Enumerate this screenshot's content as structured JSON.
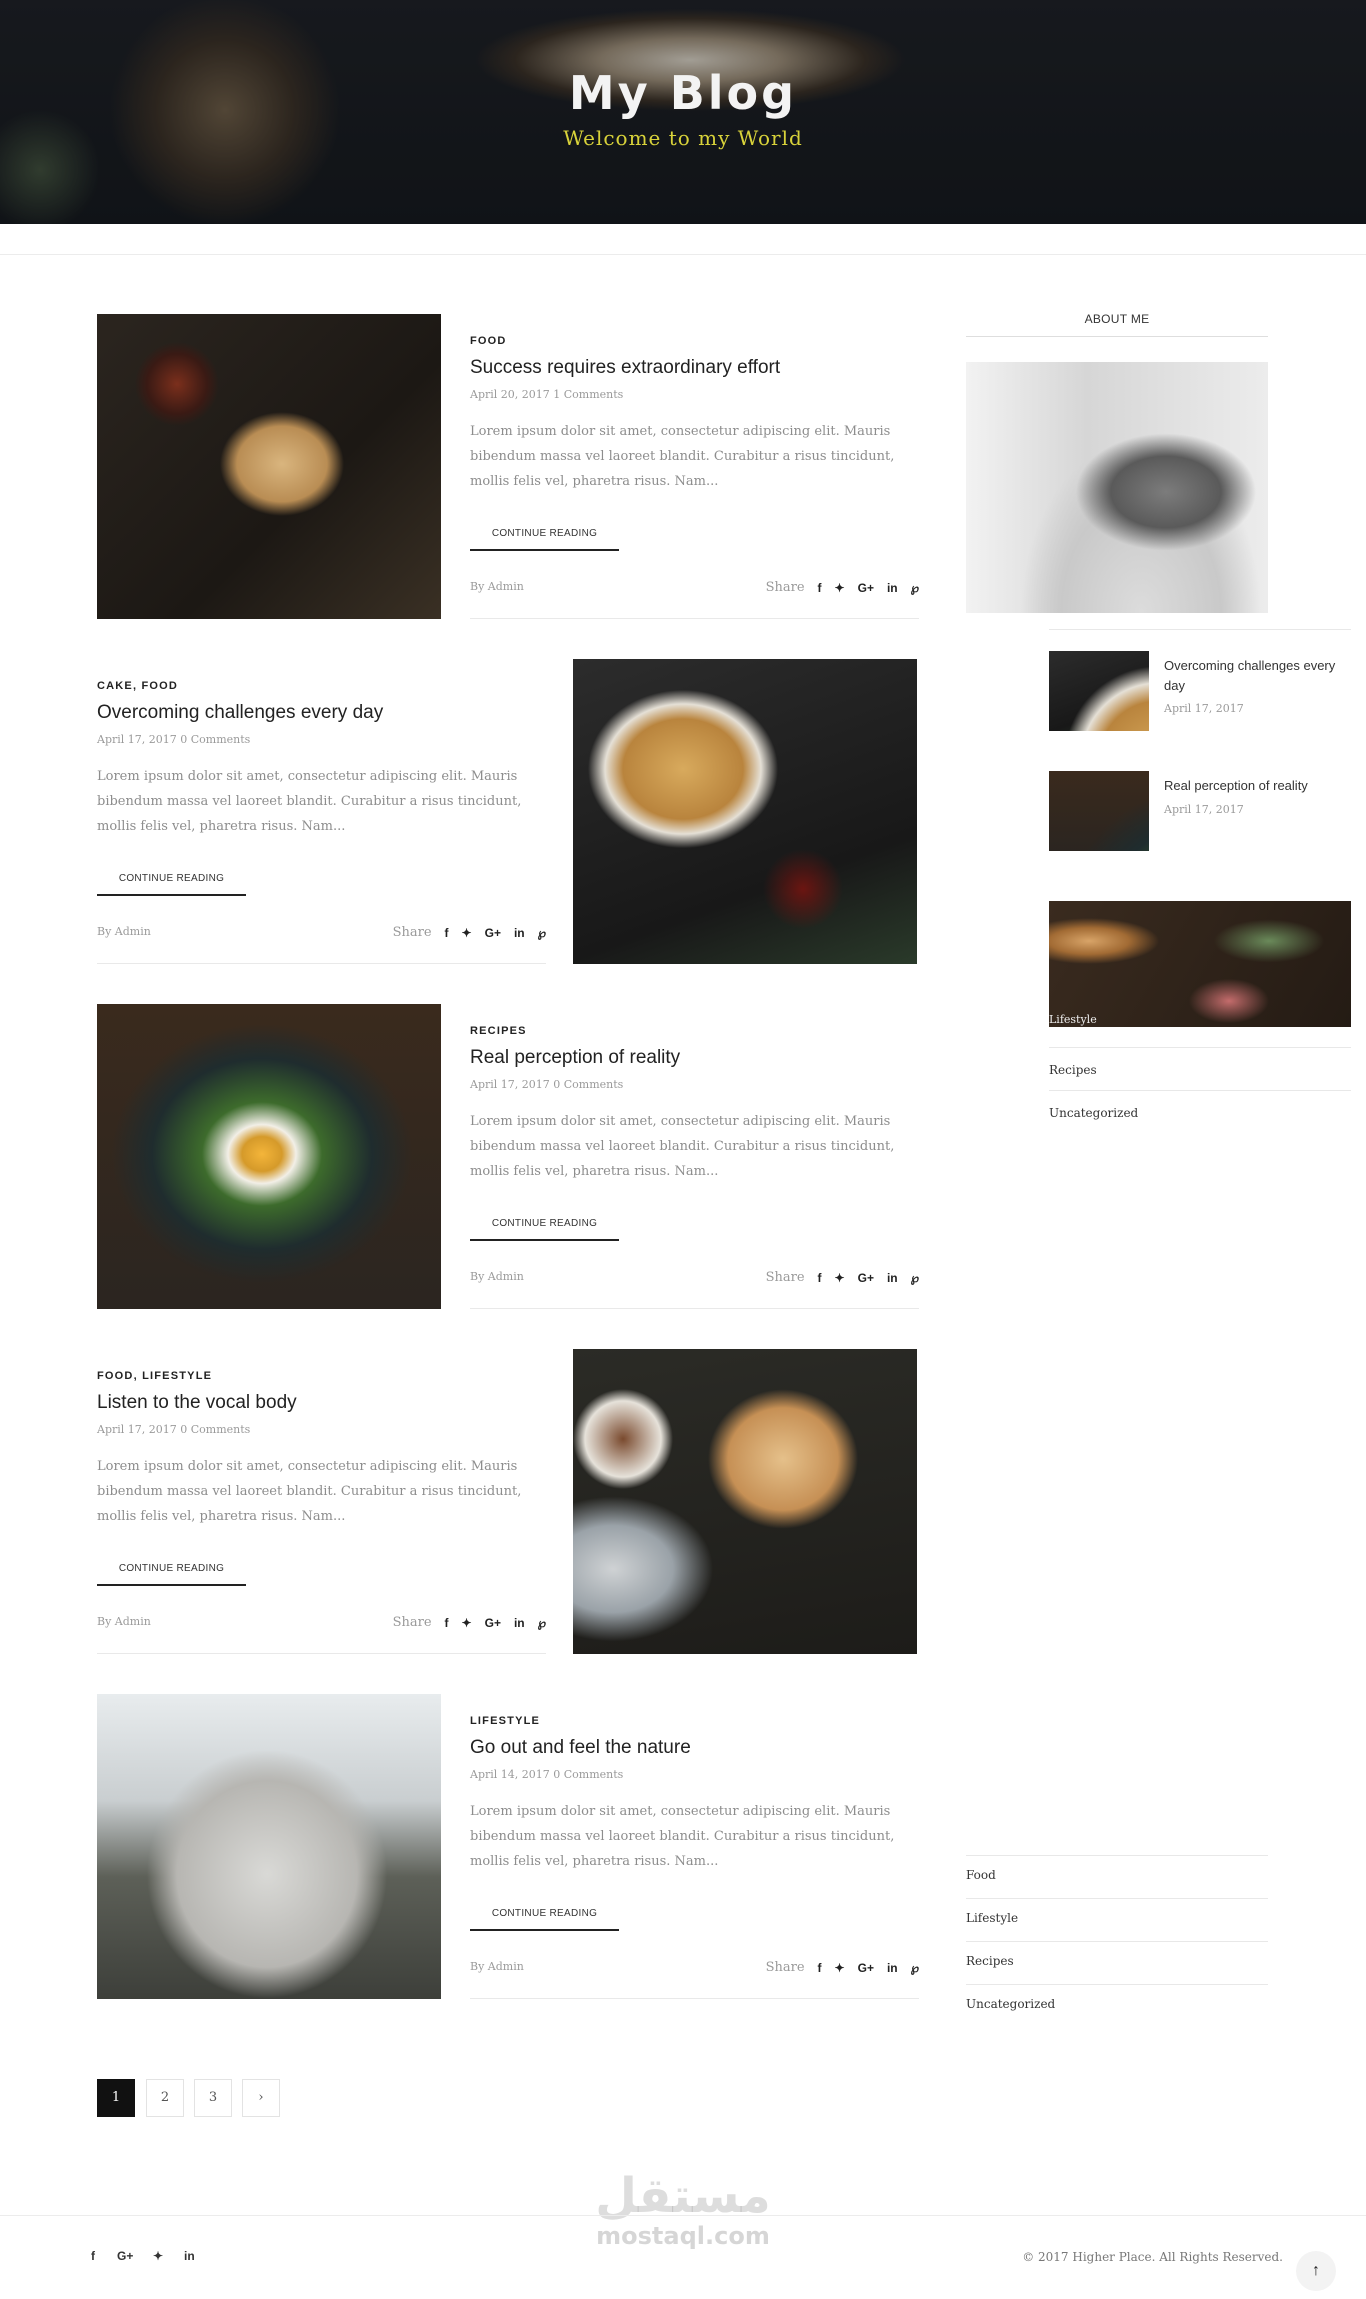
{
  "hero": {
    "title": "My Blog",
    "subtitle": "Welcome to my World"
  },
  "posts": [
    {
      "category": "FOOD",
      "title": "Success requires extraordinary effort",
      "meta": "April 20, 2017 1 Comments",
      "excerpt": "Lorem ipsum dolor sit amet, consectetur adipiscing elit. Mauris bibendum massa vel laoreet blandit. Curabitur a risus tincidunt, mollis felis vel, pharetra risus. Nam...",
      "continue": "CONTINUE READING",
      "byline": "By Admin",
      "share": "Share"
    },
    {
      "category": "CAKE, FOOD",
      "title": "Overcoming challenges every day",
      "meta": "April 17, 2017 0 Comments",
      "excerpt": "Lorem ipsum dolor sit amet, consectetur adipiscing elit. Mauris bibendum massa vel laoreet blandit. Curabitur a risus tincidunt, mollis felis vel, pharetra risus. Nam...",
      "continue": "CONTINUE READING",
      "byline": "By Admin",
      "share": "Share"
    },
    {
      "category": "RECIPES",
      "title": "Real perception of reality",
      "meta": "April 17, 2017 0 Comments",
      "excerpt": "Lorem ipsum dolor sit amet, consectetur adipiscing elit. Mauris bibendum massa vel laoreet blandit. Curabitur a risus tincidunt, mollis felis vel, pharetra risus. Nam...",
      "continue": "CONTINUE READING",
      "byline": "By Admin",
      "share": "Share"
    },
    {
      "category": "FOOD, LIFESTYLE",
      "title": "Listen to the vocal body",
      "meta": "April 17, 2017 0 Comments",
      "excerpt": "Lorem ipsum dolor sit amet, consectetur adipiscing elit. Mauris bibendum massa vel laoreet blandit. Curabitur a risus tincidunt, mollis felis vel, pharetra risus. Nam...",
      "continue": "CONTINUE READING",
      "byline": "By Admin",
      "share": "Share"
    },
    {
      "category": "LIFESTYLE",
      "title": "Go out and feel the nature",
      "meta": "April 14, 2017 0 Comments",
      "excerpt": "Lorem ipsum dolor sit amet, consectetur adipiscing elit. Mauris bibendum massa vel laoreet blandit. Curabitur a risus tincidunt, mollis felis vel, pharetra risus. Nam...",
      "continue": "CONTINUE READING",
      "byline": "By Admin",
      "share": "Share"
    }
  ],
  "share_icons": [
    "f",
    "✦",
    "G+",
    "in",
    "℘"
  ],
  "sidebar": {
    "about_heading": "ABOUT ME",
    "recent": [
      {
        "title": "Overcoming challenges every day",
        "date": "April 17, 2017"
      },
      {
        "title": "Real perception of reality",
        "date": "April 17, 2017"
      }
    ],
    "banner_caption": "Lifestyle",
    "categories_top": [
      "Recipes",
      "Uncategorized"
    ],
    "categories": [
      "Food",
      "Lifestyle",
      "Recipes",
      "Uncategorized"
    ]
  },
  "pagination": {
    "pages": [
      "1",
      "2",
      "3"
    ],
    "next": "›"
  },
  "watermark": {
    "arabic": "مستقل",
    "latin": "mostaql.com"
  },
  "footer": {
    "social": [
      "f",
      "G+",
      "✦",
      "in"
    ],
    "copyright": "© 2017 Higher Place. All Rights Reserved.",
    "to_top": "↑"
  }
}
